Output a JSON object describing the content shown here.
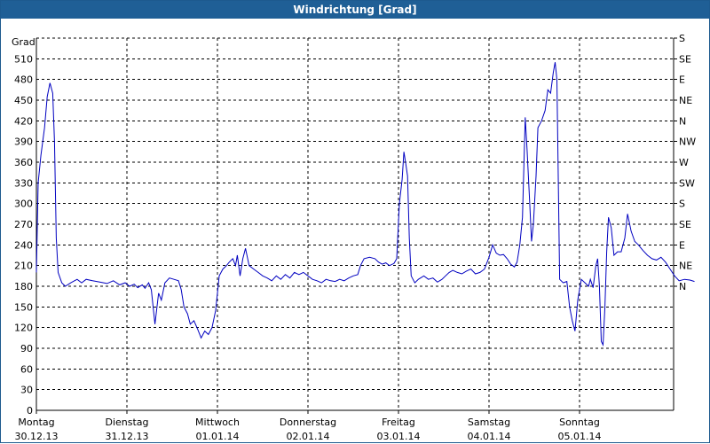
{
  "window": {
    "title": "Windrichtung [Grad]"
  },
  "chart_data": {
    "type": "line",
    "title": "Windrichtung [Grad]",
    "ylabel": "Grad",
    "ylim": [
      0,
      540
    ],
    "y_ticks": [
      0,
      30,
      60,
      90,
      120,
      150,
      180,
      210,
      240,
      270,
      300,
      330,
      360,
      390,
      420,
      450,
      480,
      510
    ],
    "right_ticks": [
      {
        "value": 540,
        "label": "S"
      },
      {
        "value": 510,
        "label": "SE"
      },
      {
        "value": 480,
        "label": "E"
      },
      {
        "value": 450,
        "label": "NE"
      },
      {
        "value": 420,
        "label": "N"
      },
      {
        "value": 390,
        "label": "NW"
      },
      {
        "value": 360,
        "label": "W"
      },
      {
        "value": 330,
        "label": "SW"
      },
      {
        "value": 300,
        "label": "S"
      },
      {
        "value": 270,
        "label": "SE"
      },
      {
        "value": 240,
        "label": "E"
      },
      {
        "value": 210,
        "label": "NE"
      },
      {
        "value": 180,
        "label": "N"
      }
    ],
    "xlim": [
      0,
      7
    ],
    "x_ticks": [
      {
        "x": 0,
        "day": "Montag",
        "date": "30.12.13"
      },
      {
        "x": 1,
        "day": "Dienstag",
        "date": "31.12.13"
      },
      {
        "x": 2,
        "day": "Mittwoch",
        "date": "01.01.14"
      },
      {
        "x": 3,
        "day": "Donnerstag",
        "date": "02.01.14"
      },
      {
        "x": 4,
        "day": "Freitag",
        "date": "03.01.14"
      },
      {
        "x": 5,
        "day": "Samstag",
        "date": "04.01.14"
      },
      {
        "x": 6,
        "day": "Sonntag",
        "date": "05.01.14"
      }
    ],
    "grid": true,
    "colors": {
      "line": "#0000c0",
      "grid": "#000000",
      "title_bar": "#1f5f96"
    },
    "series": [
      {
        "points": [
          [
            0.0,
            200
          ],
          [
            0.02,
            330
          ],
          [
            0.05,
            370
          ],
          [
            0.09,
            410
          ],
          [
            0.12,
            455
          ],
          [
            0.15,
            475
          ],
          [
            0.18,
            460
          ],
          [
            0.2,
            390
          ],
          [
            0.22,
            250
          ],
          [
            0.24,
            200
          ],
          [
            0.28,
            185
          ],
          [
            0.32,
            180
          ],
          [
            0.38,
            185
          ],
          [
            0.45,
            190
          ],
          [
            0.5,
            185
          ],
          [
            0.55,
            190
          ],
          [
            0.62,
            188
          ],
          [
            0.7,
            186
          ],
          [
            0.78,
            184
          ],
          [
            0.85,
            188
          ],
          [
            0.92,
            182
          ],
          [
            0.98,
            185
          ],
          [
            1.03,
            180
          ],
          [
            1.08,
            183
          ],
          [
            1.12,
            178
          ],
          [
            1.17,
            182
          ],
          [
            1.2,
            177
          ],
          [
            1.24,
            185
          ],
          [
            1.27,
            175
          ],
          [
            1.31,
            125
          ],
          [
            1.35,
            170
          ],
          [
            1.38,
            160
          ],
          [
            1.42,
            185
          ],
          [
            1.47,
            192
          ],
          [
            1.52,
            190
          ],
          [
            1.57,
            188
          ],
          [
            1.6,
            175
          ],
          [
            1.63,
            150
          ],
          [
            1.67,
            140
          ],
          [
            1.7,
            125
          ],
          [
            1.74,
            130
          ],
          [
            1.78,
            118
          ],
          [
            1.82,
            105
          ],
          [
            1.86,
            115
          ],
          [
            1.9,
            110
          ],
          [
            1.94,
            120
          ],
          [
            1.98,
            145
          ],
          [
            2.02,
            195
          ],
          [
            2.06,
            205
          ],
          [
            2.1,
            210
          ],
          [
            2.13,
            215
          ],
          [
            2.17,
            220
          ],
          [
            2.2,
            210
          ],
          [
            2.22,
            225
          ],
          [
            2.25,
            195
          ],
          [
            2.28,
            220
          ],
          [
            2.31,
            235
          ],
          [
            2.35,
            210
          ],
          [
            2.4,
            205
          ],
          [
            2.45,
            200
          ],
          [
            2.5,
            195
          ],
          [
            2.55,
            192
          ],
          [
            2.6,
            188
          ],
          [
            2.65,
            195
          ],
          [
            2.7,
            190
          ],
          [
            2.75,
            197
          ],
          [
            2.8,
            192
          ],
          [
            2.85,
            200
          ],
          [
            2.9,
            197
          ],
          [
            2.95,
            200
          ],
          [
            3.0,
            195
          ],
          [
            3.05,
            190
          ],
          [
            3.1,
            188
          ],
          [
            3.15,
            185
          ],
          [
            3.2,
            190
          ],
          [
            3.25,
            188
          ],
          [
            3.3,
            187
          ],
          [
            3.35,
            190
          ],
          [
            3.4,
            188
          ],
          [
            3.45,
            192
          ],
          [
            3.5,
            195
          ],
          [
            3.55,
            197
          ],
          [
            3.58,
            210
          ],
          [
            3.62,
            220
          ],
          [
            3.68,
            222
          ],
          [
            3.74,
            220
          ],
          [
            3.78,
            215
          ],
          [
            3.82,
            212
          ],
          [
            3.86,
            214
          ],
          [
            3.9,
            210
          ],
          [
            3.95,
            213
          ],
          [
            3.98,
            220
          ],
          [
            4.01,
            300
          ],
          [
            4.04,
            335
          ],
          [
            4.06,
            375
          ],
          [
            4.08,
            358
          ],
          [
            4.1,
            340
          ],
          [
            4.12,
            250
          ],
          [
            4.14,
            195
          ],
          [
            4.18,
            185
          ],
          [
            4.22,
            190
          ],
          [
            4.28,
            195
          ],
          [
            4.33,
            190
          ],
          [
            4.38,
            192
          ],
          [
            4.43,
            186
          ],
          [
            4.48,
            190
          ],
          [
            4.52,
            195
          ],
          [
            4.56,
            200
          ],
          [
            4.6,
            203
          ],
          [
            4.65,
            200
          ],
          [
            4.7,
            198
          ],
          [
            4.75,
            202
          ],
          [
            4.8,
            205
          ],
          [
            4.85,
            198
          ],
          [
            4.9,
            200
          ],
          [
            4.95,
            205
          ],
          [
            5.0,
            222
          ],
          [
            5.04,
            240
          ],
          [
            5.08,
            228
          ],
          [
            5.12,
            225
          ],
          [
            5.16,
            226
          ],
          [
            5.2,
            220
          ],
          [
            5.24,
            212
          ],
          [
            5.28,
            208
          ],
          [
            5.31,
            215
          ],
          [
            5.34,
            240
          ],
          [
            5.37,
            280
          ],
          [
            5.4,
            425
          ],
          [
            5.42,
            380
          ],
          [
            5.45,
            300
          ],
          [
            5.47,
            245
          ],
          [
            5.49,
            270
          ],
          [
            5.52,
            340
          ],
          [
            5.54,
            410
          ],
          [
            5.58,
            420
          ],
          [
            5.62,
            435
          ],
          [
            5.65,
            465
          ],
          [
            5.68,
            460
          ],
          [
            5.71,
            490
          ],
          [
            5.73,
            505
          ],
          [
            5.75,
            480
          ],
          [
            5.78,
            190
          ],
          [
            5.82,
            185
          ],
          [
            5.86,
            187
          ],
          [
            5.89,
            150
          ],
          [
            5.92,
            130
          ],
          [
            5.95,
            115
          ],
          [
            5.98,
            160
          ],
          [
            6.02,
            190
          ],
          [
            6.06,
            185
          ],
          [
            6.1,
            180
          ],
          [
            6.12,
            190
          ],
          [
            6.15,
            178
          ],
          [
            6.18,
            210
          ],
          [
            6.2,
            220
          ],
          [
            6.22,
            180
          ],
          [
            6.24,
            100
          ],
          [
            6.26,
            95
          ],
          [
            6.28,
            150
          ],
          [
            6.3,
            230
          ],
          [
            6.32,
            280
          ],
          [
            6.35,
            265
          ],
          [
            6.38,
            225
          ],
          [
            6.42,
            230
          ],
          [
            6.46,
            230
          ],
          [
            6.5,
            250
          ],
          [
            6.53,
            285
          ],
          [
            6.57,
            260
          ],
          [
            6.61,
            245
          ],
          [
            6.65,
            240
          ],
          [
            6.7,
            232
          ],
          [
            6.75,
            225
          ],
          [
            6.8,
            220
          ],
          [
            6.85,
            218
          ],
          [
            6.9,
            222
          ],
          [
            6.95,
            215
          ],
          [
            7.0,
            205
          ],
          [
            7.05,
            195
          ],
          [
            7.1,
            188
          ],
          [
            7.16,
            190
          ],
          [
            7.22,
            189
          ],
          [
            7.27,
            187
          ]
        ]
      }
    ]
  }
}
